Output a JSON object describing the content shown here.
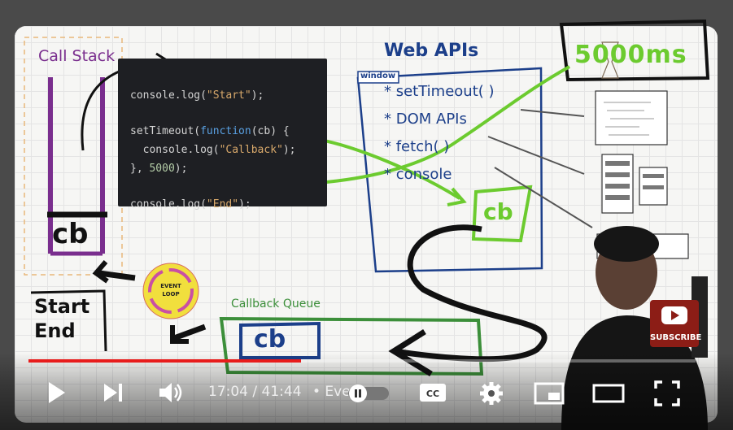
{
  "colors": {
    "accent_red": "#e81c1c",
    "purple_ink": "#7a2e8e",
    "blue_ink": "#1c3f8a",
    "green_ink": "#6ccb2f",
    "black_ink": "#111111",
    "code_bg": "#1e1f23"
  },
  "board": {
    "call_stack_label": "Call Stack",
    "call_stack_item": "cb",
    "web_apis_label": "Web APIs",
    "window_label": "window",
    "web_api_items": [
      "* setTimeout( )",
      "* DOM APIs",
      "* fetch( )",
      "* console"
    ],
    "timer_label": "5000ms",
    "cb_box_label": "cb",
    "event_loop_label_1": "EVENT",
    "event_loop_label_2": "LOOP",
    "callback_queue_label": "Callback Queue",
    "queue_item": "cb",
    "console_output": [
      "Start",
      "End"
    ]
  },
  "code": {
    "line1_fn": "console.log(",
    "line1_str": "\"Start\"",
    "line1_end": ");",
    "line2_a": "setTimeout(",
    "line2_kw": "function",
    "line2_b": "(",
    "line2_cb": "cb",
    "line2_c": ") {",
    "line3_fn": "  console.log(",
    "line3_str": "\"Callback\"",
    "line3_end": ");",
    "line4_a": "}, ",
    "line4_num": "5000",
    "line4_b": ");",
    "line5_fn": "console.log(",
    "line5_str": "\"End\"",
    "line5_end": ");"
  },
  "player": {
    "time_display": "17:04 / 41:44",
    "chapter_text": "• Eve",
    "progress_fraction": 0.409,
    "subscribe_label": "SUBSCRIBE",
    "icons": [
      "play-icon",
      "next-icon",
      "volume-icon",
      "autoplay-toggle",
      "captions-icon",
      "settings-icon",
      "miniplayer-icon",
      "theater-icon",
      "fullscreen-icon"
    ]
  }
}
